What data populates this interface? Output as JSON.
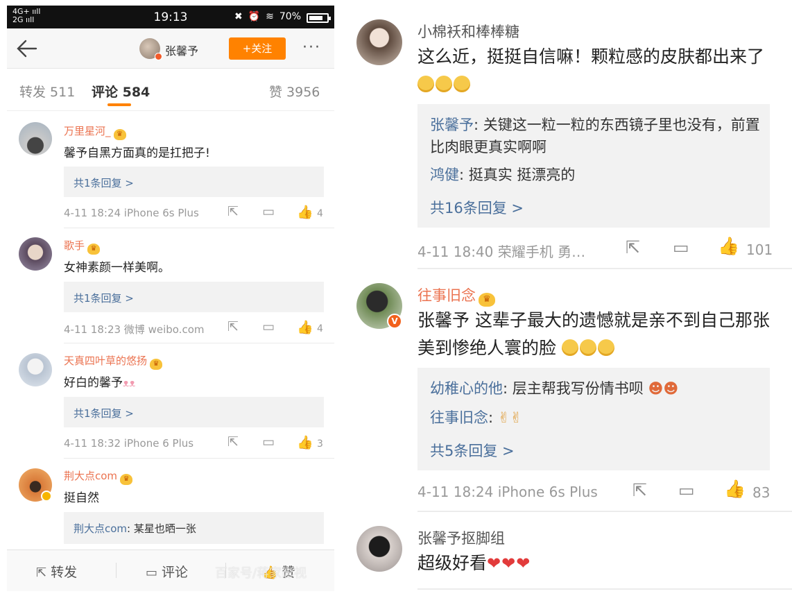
{
  "left": {
    "statusbar": {
      "net1": "4G+ ııll",
      "net2": "2G ııll",
      "time": "19:13",
      "battery": "70%"
    },
    "navbar": {
      "author": "张馨予",
      "follow_label": "+关注",
      "more_label": "···"
    },
    "tabs": {
      "repost": "转发 511",
      "comments": "评论 584",
      "likes": "赞 3956"
    },
    "comments": [
      {
        "name": "万里星河_",
        "text": "馨予自黑方面真的是扛把子!",
        "reply": "共1条回复 >",
        "time": "4-11 18:24 iPhone 6s Plus",
        "likes": "4"
      },
      {
        "name": "歌手",
        "text": "女神素颜一样美啊。",
        "reply": "共1条回复 >",
        "time": "4-11 18:23 微博 weibo.com",
        "likes": "4"
      },
      {
        "name": "天真四叶草的悠扬",
        "text": "好白的馨予",
        "reply": "共1条回复 >",
        "time": "4-11 18:32 iPhone 6 Plus",
        "likes": "3"
      },
      {
        "name": "荆大点com",
        "text": "挺自然",
        "reply_user": "荆大点com",
        "reply_text": ": 某星也晒一张"
      }
    ],
    "bottombar": {
      "repost": "转发",
      "comment": "评论",
      "like": "赞"
    },
    "watermark": "百家号/蒋家影视"
  },
  "right": {
    "comments": [
      {
        "name": "小棉袄和棒棒糖",
        "text": "这么近，挺挺自信嘛！颗粒感的皮肤都出来了",
        "replies": [
          {
            "user": "张馨予",
            "text": ": 关键这一粒一粒的东西镜子里也没有，前置比肉眼更真实啊啊"
          },
          {
            "user": "鸿健",
            "text": ": 挺真实 挺漂亮的"
          }
        ],
        "more": "共16条回复 >",
        "time": "4-11 18:40 荣耀手机 勇…",
        "likes": "101"
      },
      {
        "name": "往事旧念",
        "text": "张馨予 这辈子最大的遗憾就是亲不到自己那张美到惨绝人寰的脸",
        "replies": [
          {
            "user": "幼稚心的他",
            "text": ": 层主帮我写份情书呗"
          },
          {
            "user": "往事旧念",
            "text": ":"
          }
        ],
        "more": "共5条回复 >",
        "time": "4-11 18:24 iPhone 6s Plus",
        "likes": "83"
      },
      {
        "name": "张馨予抠脚组",
        "text": "超级好看"
      }
    ]
  },
  "colors": {
    "accent": "#ff8200",
    "username": "#eb7350",
    "link": "#4a6f9b"
  }
}
